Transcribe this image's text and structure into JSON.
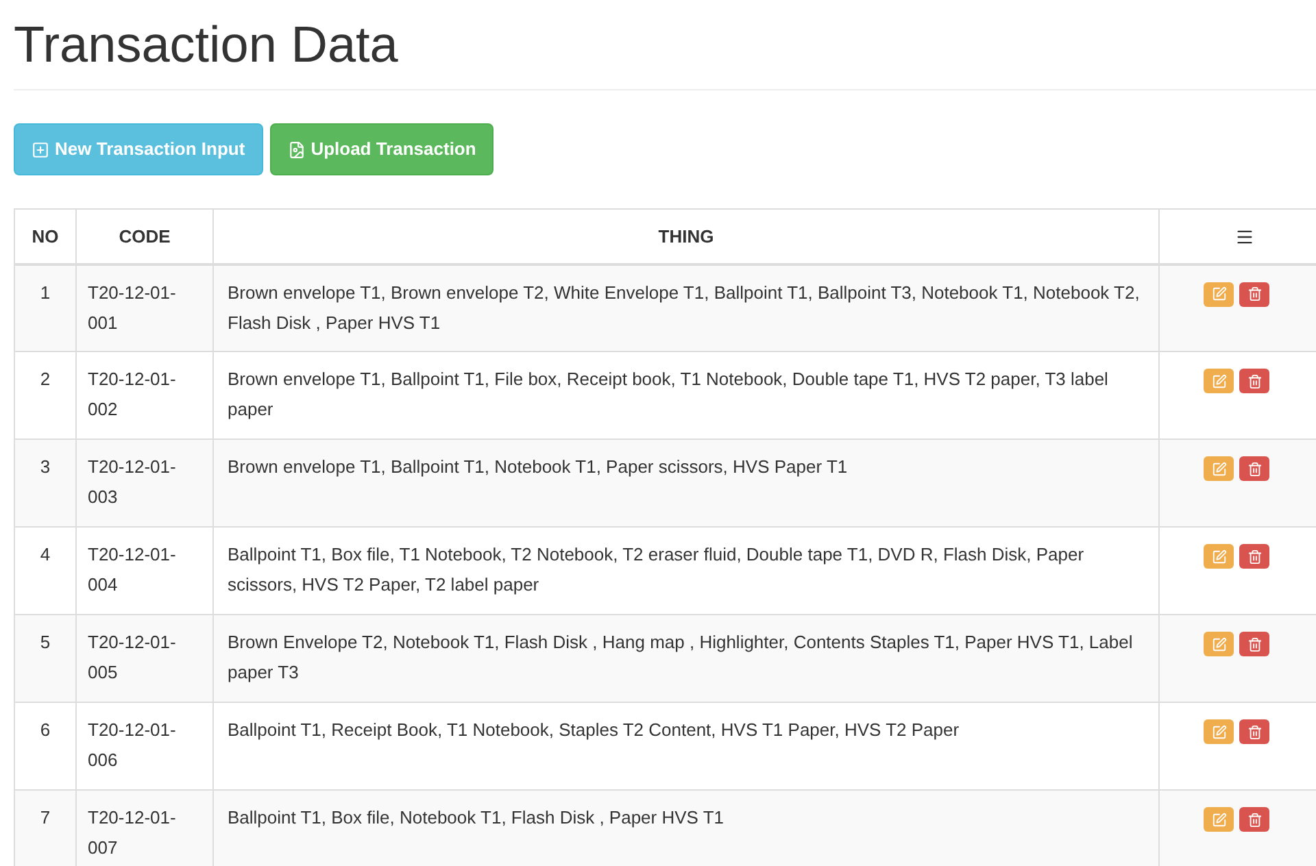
{
  "title": "Transaction Data",
  "buttons": [
    {
      "label": "New Transaction Input",
      "kind": "new"
    },
    {
      "label": "Upload Transaction",
      "kind": "upload"
    }
  ],
  "table": {
    "columns": [
      "NO",
      "CODE",
      "THING"
    ],
    "rows": [
      {
        "no": "1",
        "code": "T20-12-01-001",
        "thing": "Brown envelope T1, Brown envelope T2, White Envelope T1, Ballpoint T1, Ballpoint T3, Notebook T1, Notebook T2, Flash Disk , Paper HVS T1"
      },
      {
        "no": "2",
        "code": "T20-12-01-002",
        "thing": "Brown envelope T1, Ballpoint T1, File box, Receipt book, T1 Notebook, Double tape T1, HVS T2 paper, T3 label paper"
      },
      {
        "no": "3",
        "code": "T20-12-01-003",
        "thing": "Brown envelope T1, Ballpoint T1, Notebook T1, Paper scissors, HVS Paper T1"
      },
      {
        "no": "4",
        "code": "T20-12-01-004",
        "thing": "Ballpoint T1, Box file, T1 Notebook, T2 Notebook, T2 eraser fluid, Double tape T1, DVD R, Flash Disk, Paper scissors, HVS T2 Paper, T2 label paper"
      },
      {
        "no": "5",
        "code": "T20-12-01-005",
        "thing": "Brown Envelope T2, Notebook T1, Flash Disk , Hang map , Highlighter, Contents Staples T1, Paper HVS T1, Label paper T3"
      },
      {
        "no": "6",
        "code": "T20-12-01-006",
        "thing": "Ballpoint T1, Receipt Book, T1 Notebook, Staples T2 Content, HVS T1 Paper, HVS T2 Paper"
      },
      {
        "no": "7",
        "code": "T20-12-01-007",
        "thing": "Ballpoint T1, Box file, Notebook T1, Flash Disk , Paper HVS T1"
      }
    ]
  }
}
